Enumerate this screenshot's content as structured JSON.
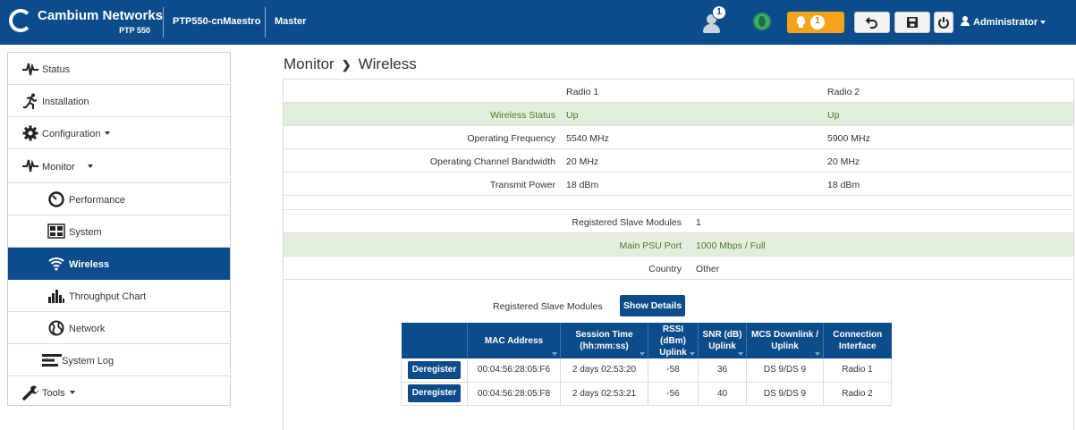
{
  "header": {
    "brand": "Cambium Networks",
    "product": "PTP 550",
    "device_name": "PTP550-cnMaestro",
    "device_role": "Master",
    "user_alert_count": "1",
    "alarm_count": "1",
    "user": "Administrator",
    "icons": [
      "user-alert-icon",
      "globe-icon",
      "bulb-icon",
      "undo-icon",
      "save-icon",
      "power-icon",
      "user-icon"
    ],
    "colors": {
      "brand": "#0c4c8a",
      "alarm": "#f5a31a",
      "connected": "#3bb26b"
    }
  },
  "sidebar": {
    "items": [
      {
        "label": "Status"
      },
      {
        "label": "Installation"
      },
      {
        "label": "Configuration"
      },
      {
        "label": "Monitor"
      },
      {
        "label": "Performance"
      },
      {
        "label": "System"
      },
      {
        "label": "Wireless"
      },
      {
        "label": "Throughput Chart"
      },
      {
        "label": "Network"
      },
      {
        "label": "System Log"
      },
      {
        "label": "Tools"
      }
    ],
    "active": "Wireless"
  },
  "page": {
    "section": "Monitor",
    "title": "Wireless"
  },
  "radio_table": {
    "headers": [
      "Radio 1",
      "Radio 2"
    ],
    "rows": [
      {
        "label": "Wireless Status",
        "r1": "Up",
        "r2": "Up"
      },
      {
        "label": "Operating Frequency",
        "r1": "5540 MHz",
        "r2": "5900 MHz"
      },
      {
        "label": "Operating Channel Bandwidth",
        "r1": "20 MHz",
        "r2": "20 MHz"
      },
      {
        "label": "Transmit Power",
        "r1": "18 dBm",
        "r2": "18 dBm"
      }
    ]
  },
  "info_table": {
    "rows": [
      {
        "label": "Registered Slave Modules",
        "value": "1"
      },
      {
        "label": "Main PSU Port",
        "value": "1000 Mbps / Full"
      },
      {
        "label": "Country",
        "value": "Other"
      }
    ]
  },
  "slaves": {
    "label": "Registered Slave Modules",
    "show_details": "Show Details",
    "columns": [
      "MAC Address",
      "Session Time (hh:mm:ss)",
      "RSSI (dBm) Uplink",
      "SNR (dB) Uplink",
      "MCS Downlink / Uplink",
      "Connection Interface"
    ],
    "column_lines": [
      [
        "MAC Address"
      ],
      [
        "Session Time",
        "(hh:mm:ss)"
      ],
      [
        "RSSI (dBm)",
        "Uplink"
      ],
      [
        "SNR (dB)",
        "Uplink"
      ],
      [
        "MCS Downlink /",
        "Uplink"
      ],
      [
        "Connection",
        "Interface"
      ]
    ],
    "action_label": "Deregister",
    "rows": [
      {
        "mac": "00:04:56:28:05:F6",
        "session": "2 days 02:53:20",
        "rssi": "-58",
        "snr": "36",
        "mcs": "DS 9/DS 9",
        "iface": "Radio 1"
      },
      {
        "mac": "00:04:56:28:05:F8",
        "session": "2 days 02:53:21",
        "rssi": "-56",
        "snr": "40",
        "mcs": "DS 9/DS 9",
        "iface": "Radio 2"
      }
    ]
  }
}
